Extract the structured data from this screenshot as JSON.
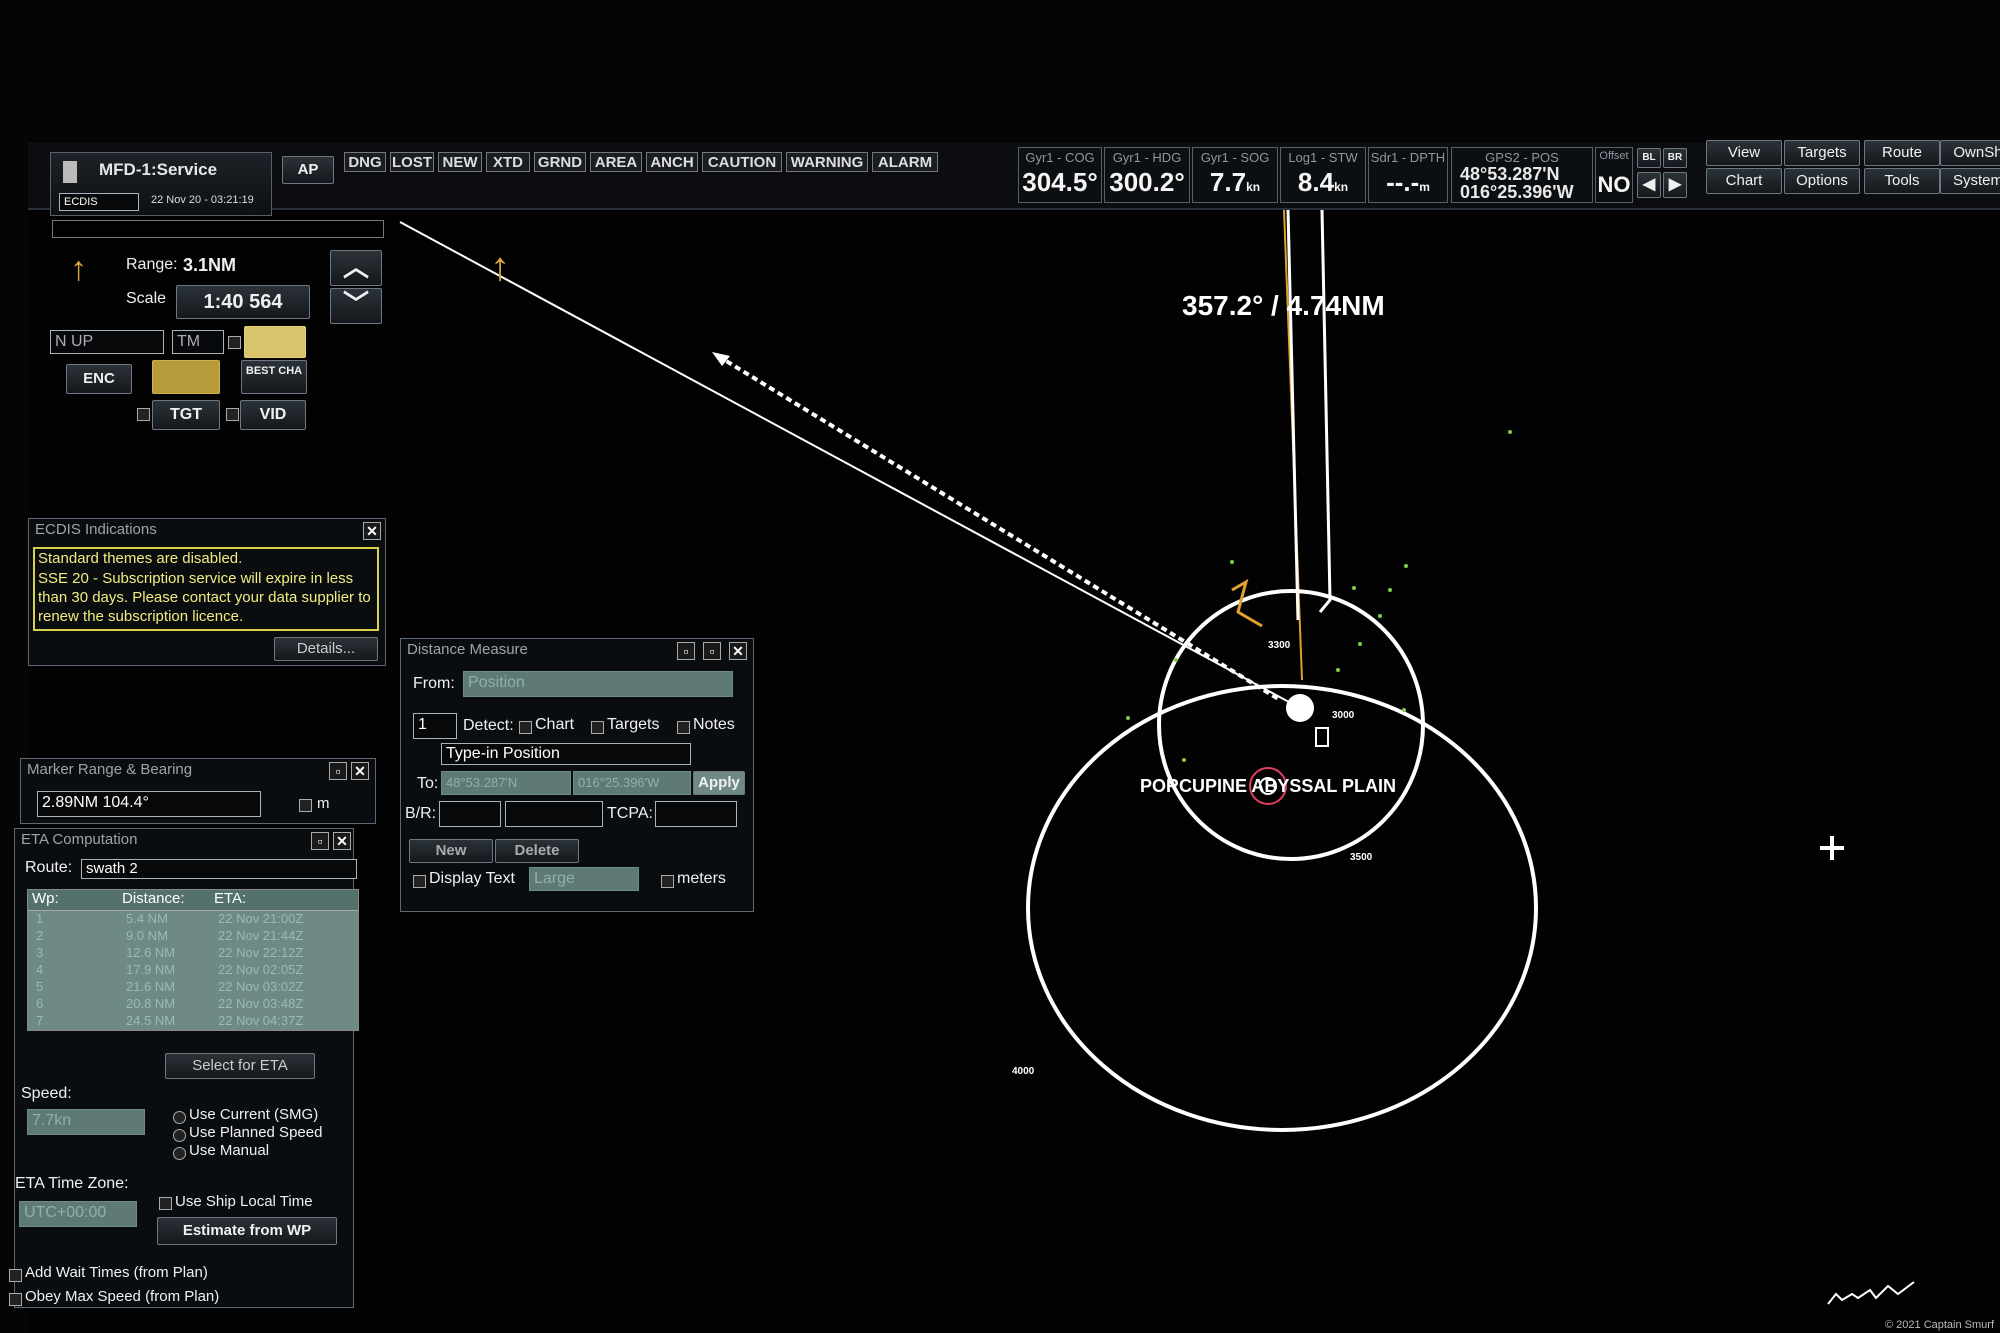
{
  "app": {
    "title": "MFD-1:Service",
    "mode": "ECDIS",
    "datetime": "22 Nov 20 - 03:21:19",
    "ap_label": "AP"
  },
  "alert_tabs": [
    "DNG",
    "LOST",
    "NEW",
    "XTD",
    "GRND",
    "AREA",
    "ANCH",
    "CAUTION",
    "WARNING",
    "ALARM"
  ],
  "sensors": [
    {
      "label": "Gyr1 - COG",
      "value": "304.5°"
    },
    {
      "label": "Gyr1 - HDG",
      "value": "300.2°"
    },
    {
      "label": "Gyr1 - SOG",
      "value": "7.7",
      "unit": "kn"
    },
    {
      "label": "Log1 - STW",
      "value": "8.4",
      "unit": "kn"
    },
    {
      "label": "Sdr1 - DPTH",
      "value": "--.-",
      "unit": "m"
    }
  ],
  "position": {
    "label": "GPS2 - POS",
    "lat": "48°53.287'N",
    "lon": "016°25.396'W"
  },
  "offset": {
    "label": "Offset",
    "value": "NO"
  },
  "bl_br": [
    "BL",
    "BR"
  ],
  "menu": {
    "row1": [
      "View",
      "Targets",
      "Route",
      "OwnSh"
    ],
    "row2": [
      "Chart",
      "Options",
      "Tools",
      "System"
    ]
  },
  "range_panel": {
    "range_label": "Range:",
    "range_value": "3.1NM",
    "scale_label": "Scale",
    "scale_value": "1:40 564",
    "orientation": "N UP",
    "motion": "TM",
    "enc": "ENC",
    "best_cha": "BEST CHA",
    "tgt": "TGT",
    "vid": "VID"
  },
  "ecdis_indications": {
    "title": "ECDIS Indications",
    "messages": [
      "Standard themes are disabled.",
      "SSE 20 - Subscription service will expire in less than 30 days. Please contact your data supplier to renew the subscription licence."
    ],
    "details": "Details..."
  },
  "marker_rb": {
    "title": "Marker Range & Bearing",
    "value": "2.89NM  104.4°",
    "unit": "m"
  },
  "eta": {
    "title": "ETA Computation",
    "route_label": "Route:",
    "route_value": "swath 2",
    "columns": [
      "Wp:",
      "Distance:",
      "ETA:"
    ],
    "rows": [
      [
        "1",
        "5.4 NM",
        "22 Nov 21:00Z"
      ],
      [
        "2",
        "9.0 NM",
        "22 Nov 21:44Z"
      ],
      [
        "3",
        "12.6 NM",
        "22 Nov 22:12Z"
      ],
      [
        "4",
        "17.9 NM",
        "22 Nov 02:05Z"
      ],
      [
        "5",
        "21.6 NM",
        "22 Nov 03:02Z"
      ],
      [
        "6",
        "20.8 NM",
        "22 Nov 03:48Z"
      ],
      [
        "7",
        "24.5 NM",
        "22 Nov 04:37Z"
      ]
    ],
    "select_btn": "Select for ETA",
    "speed_label": "Speed:",
    "speed_value": "7.7kn",
    "speed_options": [
      "Use Current (SMG)",
      "Use Planned Speed",
      "Use Manual"
    ],
    "tz_label": "ETA Time Zone:",
    "tz_value": "UTC+00:00",
    "ship_local": "Use Ship Local Time",
    "estimate_btn": "Estimate from WP",
    "add_wait": "Add Wait Times (from Plan)",
    "obey_max": "Obey Max Speed (from Plan)"
  },
  "distance_measure": {
    "title": "Distance Measure",
    "from_label": "From:",
    "from_value": "Position",
    "index": "1",
    "detect_label": "Detect:",
    "detect_options": [
      "Chart",
      "Targets",
      "Notes"
    ],
    "typein": "Type-in Position",
    "to_label": "To:",
    "to_lat": "48°53.287'N",
    "to_lon": "016°25.396'W",
    "apply": "Apply",
    "br_label": "B/R:",
    "tcpa_label": "TCPA:",
    "new_btn": "New",
    "delete_btn": "Delete",
    "display_text": "Display Text",
    "display_value": "Large",
    "meters": "meters"
  },
  "chart": {
    "bearing_label": "357.2° / 4.74NM",
    "place_name": "PORCUPINE ABYSSAL PLAIN",
    "depth_labels": [
      "3300",
      "3000",
      "3500",
      "4000"
    ]
  },
  "copyright": "© 2021 Captain Smurf"
}
